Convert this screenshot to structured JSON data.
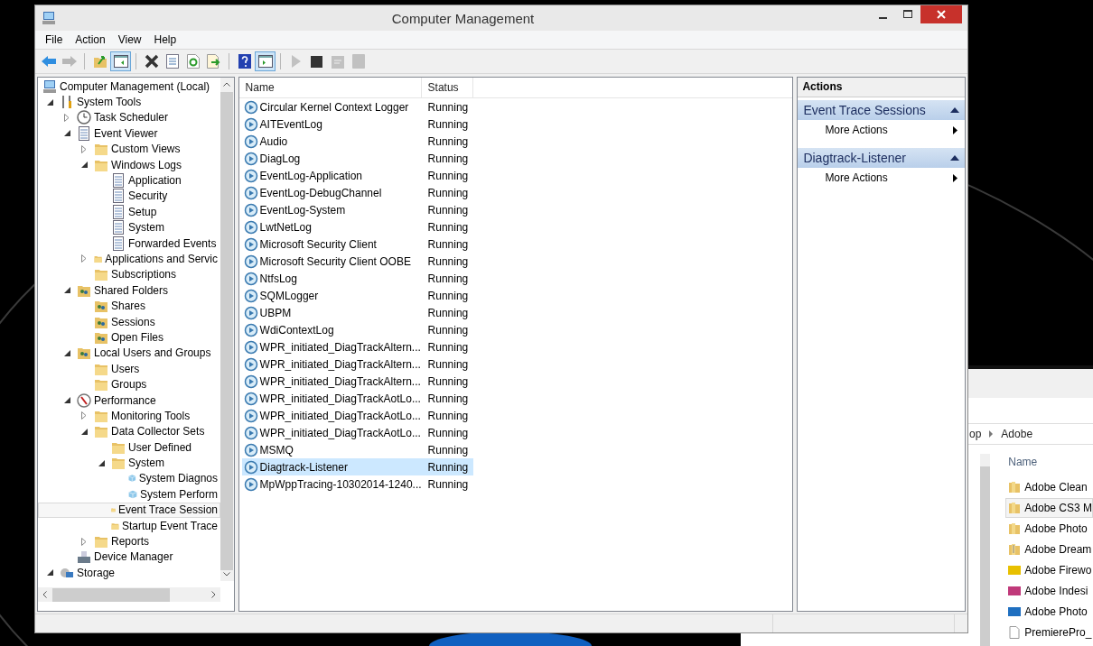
{
  "window": {
    "title": "Computer Management"
  },
  "menu": [
    "File",
    "Action",
    "View",
    "Help"
  ],
  "toolbar": [
    [
      {
        "kind": "back",
        "pressed": false,
        "disabled": false
      },
      {
        "kind": "forward",
        "pressed": false,
        "disabled": true
      }
    ],
    [
      {
        "kind": "up",
        "pressed": false,
        "disabled": false
      },
      {
        "kind": "tree-pane",
        "pressed": true,
        "disabled": false
      }
    ],
    [
      {
        "kind": "delete",
        "pressed": false,
        "disabled": false
      },
      {
        "kind": "properties",
        "pressed": false,
        "disabled": false
      },
      {
        "kind": "refresh",
        "pressed": false,
        "disabled": false
      },
      {
        "kind": "export",
        "pressed": false,
        "disabled": false
      }
    ],
    [
      {
        "kind": "help",
        "pressed": false,
        "disabled": false
      },
      {
        "kind": "action-pane",
        "pressed": true,
        "disabled": false
      }
    ],
    [
      {
        "kind": "play",
        "pressed": false,
        "disabled": true
      },
      {
        "kind": "stop",
        "pressed": false,
        "disabled": false
      },
      {
        "kind": "note",
        "pressed": false,
        "disabled": true
      },
      {
        "kind": "square",
        "pressed": false,
        "disabled": true
      }
    ]
  ],
  "tree": [
    {
      "label": "Computer Management (Local)",
      "kind": "computer",
      "selected": false,
      "children": [
        {
          "label": "System Tools",
          "kind": "tools",
          "expanded": true,
          "selected": false,
          "children": [
            {
              "label": "Task Scheduler",
              "kind": "clock",
              "expanded": false,
              "selected": false
            },
            {
              "label": "Event Viewer",
              "kind": "log",
              "expanded": true,
              "selected": false,
              "children": [
                {
                  "label": "Custom Views",
                  "kind": "folder",
                  "expanded": false,
                  "selected": false
                },
                {
                  "label": "Windows Logs",
                  "kind": "folder",
                  "expanded": true,
                  "selected": false,
                  "children": [
                    {
                      "label": "Application",
                      "kind": "log",
                      "selected": false
                    },
                    {
                      "label": "Security",
                      "kind": "log",
                      "selected": false
                    },
                    {
                      "label": "Setup",
                      "kind": "log",
                      "selected": false
                    },
                    {
                      "label": "System",
                      "kind": "log",
                      "selected": false
                    },
                    {
                      "label": "Forwarded Events",
                      "kind": "log",
                      "selected": false
                    }
                  ]
                },
                {
                  "label": "Applications and Servic",
                  "kind": "folder",
                  "expanded": false,
                  "selected": false
                },
                {
                  "label": "Subscriptions",
                  "kind": "folder",
                  "selected": false
                }
              ]
            },
            {
              "label": "Shared Folders",
              "kind": "users",
              "expanded": true,
              "selected": false,
              "children": [
                {
                  "label": "Shares",
                  "kind": "users",
                  "selected": false
                },
                {
                  "label": "Sessions",
                  "kind": "users",
                  "selected": false
                },
                {
                  "label": "Open Files",
                  "kind": "users",
                  "selected": false
                }
              ]
            },
            {
              "label": "Local Users and Groups",
              "kind": "users",
              "expanded": true,
              "selected": false,
              "children": [
                {
                  "label": "Users",
                  "kind": "folder",
                  "selected": false
                },
                {
                  "label": "Groups",
                  "kind": "folder",
                  "selected": false
                }
              ]
            },
            {
              "label": "Performance",
              "kind": "gauge",
              "expanded": true,
              "selected": false,
              "children": [
                {
                  "label": "Monitoring Tools",
                  "kind": "folder",
                  "expanded": false,
                  "selected": false
                },
                {
                  "label": "Data Collector Sets",
                  "kind": "folder",
                  "expanded": true,
                  "selected": false,
                  "children": [
                    {
                      "label": "User Defined",
                      "kind": "folder",
                      "selected": false
                    },
                    {
                      "label": "System",
                      "kind": "folder",
                      "expanded": true,
                      "selected": false,
                      "children": [
                        {
                          "label": "System Diagnos",
                          "kind": "cube",
                          "selected": false
                        },
                        {
                          "label": "System Perform",
                          "kind": "cube",
                          "selected": false
                        }
                      ]
                    },
                    {
                      "label": "Event Trace Session",
                      "kind": "folder",
                      "selected": true
                    },
                    {
                      "label": "Startup Event Trace",
                      "kind": "folder",
                      "selected": false
                    }
                  ]
                },
                {
                  "label": "Reports",
                  "kind": "folder",
                  "expanded": false,
                  "selected": false
                }
              ]
            },
            {
              "label": "Device Manager",
              "kind": "device",
              "selected": false
            }
          ]
        },
        {
          "label": "Storage",
          "kind": "storage",
          "expanded": true,
          "selected": false
        }
      ]
    }
  ],
  "list": {
    "columns": [
      "Name",
      "Status"
    ],
    "rows": [
      {
        "name": "Circular Kernel Context Logger",
        "status": "Running",
        "selected": false
      },
      {
        "name": "AITEventLog",
        "status": "Running",
        "selected": false
      },
      {
        "name": "Audio",
        "status": "Running",
        "selected": false
      },
      {
        "name": "DiagLog",
        "status": "Running",
        "selected": false
      },
      {
        "name": "EventLog-Application",
        "status": "Running",
        "selected": false
      },
      {
        "name": "EventLog-DebugChannel",
        "status": "Running",
        "selected": false
      },
      {
        "name": "EventLog-System",
        "status": "Running",
        "selected": false
      },
      {
        "name": "LwtNetLog",
        "status": "Running",
        "selected": false
      },
      {
        "name": "Microsoft Security Client",
        "status": "Running",
        "selected": false
      },
      {
        "name": "Microsoft Security Client OOBE",
        "status": "Running",
        "selected": false
      },
      {
        "name": "NtfsLog",
        "status": "Running",
        "selected": false
      },
      {
        "name": "SQMLogger",
        "status": "Running",
        "selected": false
      },
      {
        "name": "UBPM",
        "status": "Running",
        "selected": false
      },
      {
        "name": "WdiContextLog",
        "status": "Running",
        "selected": false
      },
      {
        "name": "WPR_initiated_DiagTrackAltern...",
        "status": "Running",
        "selected": false
      },
      {
        "name": "WPR_initiated_DiagTrackAltern...",
        "status": "Running",
        "selected": false
      },
      {
        "name": "WPR_initiated_DiagTrackAltern...",
        "status": "Running",
        "selected": false
      },
      {
        "name": "WPR_initiated_DiagTrackAotLo...",
        "status": "Running",
        "selected": false
      },
      {
        "name": "WPR_initiated_DiagTrackAotLo...",
        "status": "Running",
        "selected": false
      },
      {
        "name": "WPR_initiated_DiagTrackAotLo...",
        "status": "Running",
        "selected": false
      },
      {
        "name": "MSMQ",
        "status": "Running",
        "selected": false
      },
      {
        "name": "Diagtrack-Listener",
        "status": "Running",
        "selected": true
      },
      {
        "name": "MpWppTracing-10302014-1240...",
        "status": "Running",
        "selected": false
      }
    ]
  },
  "actions": {
    "title": "Actions",
    "sections": [
      {
        "title": "Event Trace Sessions",
        "items": [
          "More Actions"
        ]
      },
      {
        "title": "Diagtrack-Listener",
        "items": [
          "More Actions"
        ]
      }
    ]
  },
  "background_window": {
    "breadcrumb": [
      "op",
      "Adobe"
    ],
    "column": "Name",
    "files": [
      {
        "name": "Adobe Clean",
        "kind": "folder",
        "hovered": false
      },
      {
        "name": "Adobe CS3 M",
        "kind": "folder",
        "hovered": true
      },
      {
        "name": "Adobe Photo",
        "kind": "folder",
        "hovered": false
      },
      {
        "name": "Adobe Dream",
        "kind": "zip",
        "hovered": false
      },
      {
        "name": "Adobe Firewo",
        "kind": "fireworks",
        "hovered": false
      },
      {
        "name": "Adobe Indesi",
        "kind": "indesign",
        "hovered": false
      },
      {
        "name": "Adobe Photo",
        "kind": "photoshop",
        "hovered": false
      },
      {
        "name": "PremierePro_",
        "kind": "file",
        "hovered": false
      }
    ]
  }
}
